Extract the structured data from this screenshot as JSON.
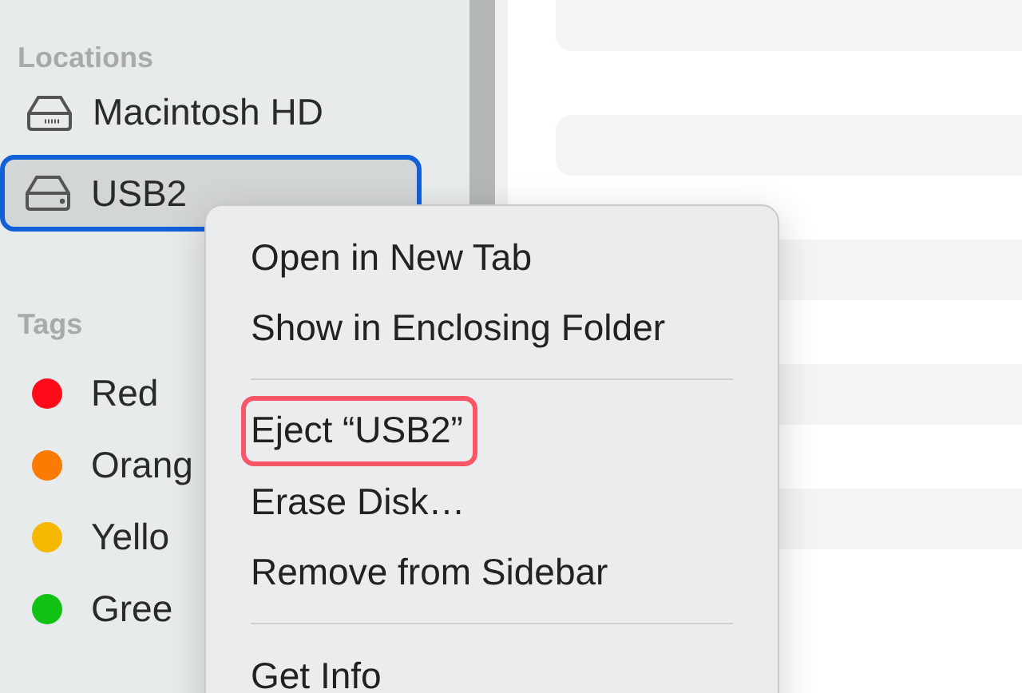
{
  "sidebar": {
    "sections": [
      {
        "title": "Locations",
        "items": [
          {
            "kind": "disk",
            "label": "Macintosh HD",
            "selected": false
          },
          {
            "kind": "usb",
            "label": "USB2",
            "selected": true
          }
        ]
      },
      {
        "title": "Tags",
        "items": [
          {
            "kind": "tag",
            "label": "Red",
            "color": "#ff0b1a",
            "selected": false
          },
          {
            "kind": "tag",
            "label": "Orang",
            "color": "#fb7a00",
            "selected": false
          },
          {
            "kind": "tag",
            "label": "Yello",
            "color": "#f6b800",
            "selected": false
          },
          {
            "kind": "tag",
            "label": "Gree",
            "color": "#11c114",
            "selected": false
          }
        ]
      }
    ]
  },
  "context_menu": {
    "items": [
      {
        "kind": "item",
        "label": "Open in New Tab",
        "highlighted": false
      },
      {
        "kind": "item",
        "label": "Show in Enclosing Folder",
        "highlighted": false
      },
      {
        "kind": "separator"
      },
      {
        "kind": "item",
        "label": "Eject “USB2”",
        "highlighted": true
      },
      {
        "kind": "item",
        "label": "Erase Disk…",
        "highlighted": false
      },
      {
        "kind": "item",
        "label": "Remove from Sidebar",
        "highlighted": false
      },
      {
        "kind": "separator"
      },
      {
        "kind": "item",
        "label": "Get Info",
        "highlighted": false
      }
    ]
  }
}
